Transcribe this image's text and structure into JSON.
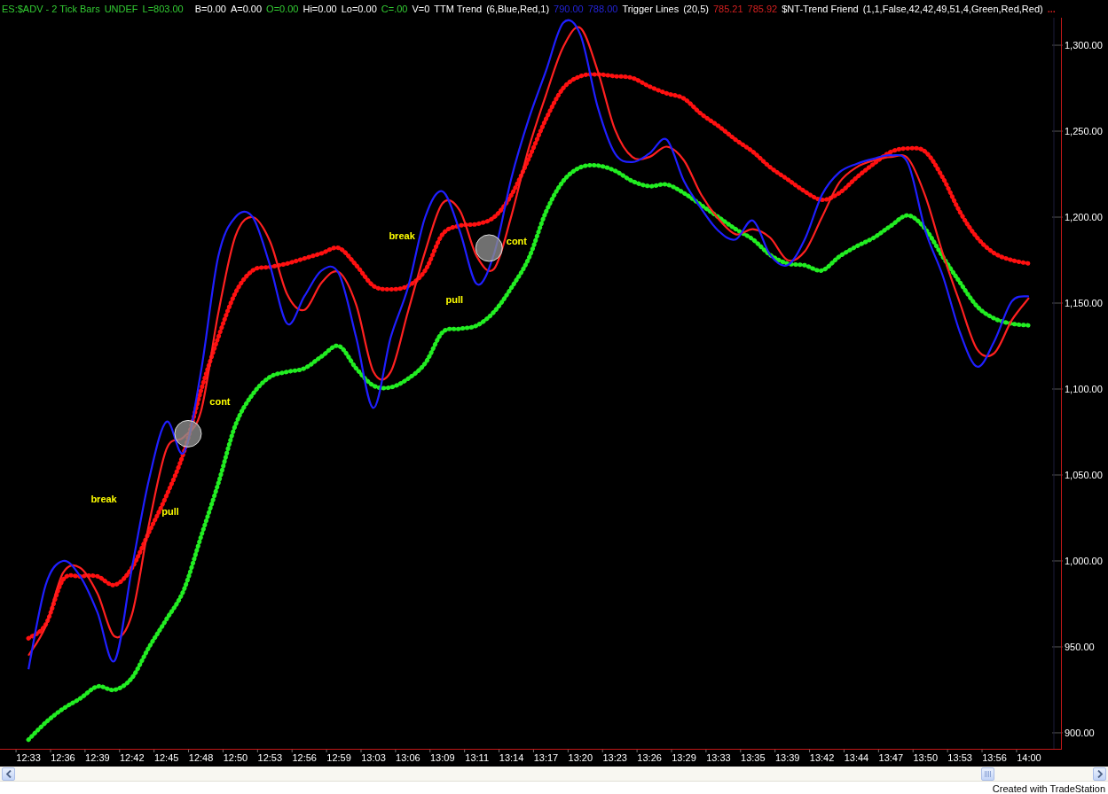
{
  "legend": [
    {
      "items": [
        {
          "text": "ES:$ADV - 2 Tick Bars",
          "color": "#33cc33"
        },
        {
          "text": "UNDEF",
          "color": "#33cc33"
        },
        {
          "text": "L=803.00",
          "color": "#33cc33"
        }
      ]
    },
    {
      "items": [
        {
          "text": "B=0.00",
          "color": "#ffffff"
        },
        {
          "text": "A=0.00",
          "color": "#ffffff"
        },
        {
          "text": "O=0.00",
          "color": "#33cc33"
        },
        {
          "text": "Hi=0.00",
          "color": "#ffffff"
        },
        {
          "text": "Lo=0.00",
          "color": "#ffffff"
        },
        {
          "text": "C=.00",
          "color": "#33cc33"
        },
        {
          "text": "V=0",
          "color": "#ffffff"
        }
      ]
    },
    {
      "items": [
        {
          "text": "TTM Trend",
          "color": "#ffffff"
        },
        {
          "text": "(6,Blue,Red,1)",
          "color": "#ffffff"
        }
      ]
    },
    {
      "items": [
        {
          "text": "790.00",
          "color": "#2424d8"
        },
        {
          "text": "788.00",
          "color": "#2424d8"
        }
      ]
    },
    {
      "items": [
        {
          "text": "Trigger Lines",
          "color": "#ffffff"
        },
        {
          "text": "(20,5)",
          "color": "#ffffff"
        }
      ]
    },
    {
      "items": [
        {
          "text": "785.21",
          "color": "#d42020"
        },
        {
          "text": "785.92",
          "color": "#d42020"
        }
      ]
    },
    {
      "items": [
        {
          "text": "$NT-Trend Friend",
          "color": "#ffffff"
        },
        {
          "text": "(1,1,False,42,42,49,51,4,Green,Red,Red)",
          "color": "#ffffff"
        }
      ]
    },
    {
      "items": [
        {
          "text": "...",
          "color": "#d42020"
        }
      ]
    }
  ],
  "chart": {
    "chart_data": {
      "type": "line",
      "categories": [
        "12:33",
        null,
        "12:36",
        null,
        "12:39",
        null,
        "12:42",
        null,
        "12:45",
        null,
        "12:48",
        null,
        "12:50",
        null,
        "12:53",
        null,
        "12:56",
        null,
        "12:59",
        null,
        "13:03",
        null,
        "13:06",
        null,
        "13:09",
        null,
        "13:11",
        null,
        "13:14",
        null,
        "13:17",
        null,
        "13:20",
        null,
        "13:23",
        null,
        "13:26",
        null,
        "13:29",
        null,
        "13:33",
        null,
        "13:35",
        null,
        "13:39",
        null,
        "13:42",
        null,
        "13:44",
        null,
        "13:47",
        null,
        "13:50",
        null,
        "13:53",
        null,
        "13:56",
        null,
        "14:00"
      ],
      "ylim": [
        890.7,
        1316
      ],
      "yticks": [
        {
          "value": 1300,
          "label": "1,300.00"
        },
        {
          "value": 1250,
          "label": "1,250.00"
        },
        {
          "value": 1200,
          "label": "1,200.00"
        },
        {
          "value": 1150,
          "label": "1,150.00"
        },
        {
          "value": 1100,
          "label": "1,100.00"
        },
        {
          "value": 1050,
          "label": "1,050.00"
        },
        {
          "value": 1000,
          "label": "1,000.00"
        },
        {
          "value": 950,
          "label": "950.00"
        },
        {
          "value": 900,
          "label": "900.00"
        }
      ],
      "series": [
        {
          "color": "#ff1010",
          "line_style": "dotted",
          "values": [
            955,
            963,
            989,
            991,
            991,
            986,
            996,
            1017,
            1038,
            1063,
            1099,
            1130,
            1156,
            1169,
            1171,
            1173,
            1176,
            1179,
            1182,
            1172,
            1160,
            1158,
            1160,
            1169,
            1190,
            1195,
            1196,
            1200,
            1213,
            1234,
            1257,
            1275,
            1282,
            1283,
            1282,
            1281,
            1276,
            1272,
            1269,
            1260,
            1253,
            1245,
            1238,
            1229,
            1222,
            1215,
            1210,
            1214,
            1223,
            1231,
            1238,
            1240,
            1238,
            1223,
            1203,
            1188,
            1179,
            1175,
            1173
          ]
        },
        {
          "color": "#22ee22",
          "line_style": "dotted",
          "values": [
            896,
            906,
            914,
            920,
            927,
            925,
            932,
            950,
            966,
            983,
            1014,
            1045,
            1079,
            1097,
            1107,
            1110,
            1112,
            1119,
            1125,
            1112,
            1102,
            1101,
            1106,
            1115,
            1133,
            1135,
            1137,
            1145,
            1159,
            1176,
            1203,
            1221,
            1229,
            1230,
            1227,
            1221,
            1218,
            1219,
            1214,
            1207,
            1200,
            1193,
            1187,
            1178,
            1173,
            1172,
            1169,
            1177,
            1183,
            1188,
            1195,
            1201,
            1193,
            1177,
            1162,
            1148,
            1141,
            1138,
            1137
          ]
        },
        {
          "color": "#ff2020",
          "line_style": "solid",
          "values": [
            945,
            962,
            993,
            996,
            981,
            956,
            969,
            1022,
            1065,
            1072,
            1087,
            1144,
            1189,
            1200,
            1186,
            1155,
            1146,
            1162,
            1168,
            1149,
            1110,
            1110,
            1145,
            1180,
            1208,
            1204,
            1177,
            1170,
            1201,
            1240,
            1271,
            1299,
            1310,
            1285,
            1251,
            1235,
            1235,
            1241,
            1233,
            1213,
            1199,
            1190,
            1193,
            1188,
            1175,
            1180,
            1200,
            1220,
            1229,
            1233,
            1235,
            1234,
            1212,
            1179,
            1150,
            1123,
            1121,
            1140,
            1153
          ]
        },
        {
          "color": "#1f1fff",
          "line_style": "solid",
          "values": [
            937,
            986,
            1000,
            991,
            970,
            942,
            996,
            1048,
            1081,
            1063,
            1110,
            1177,
            1200,
            1200,
            1172,
            1138,
            1154,
            1169,
            1167,
            1130,
            1089,
            1130,
            1159,
            1200,
            1215,
            1192,
            1161,
            1179,
            1223,
            1257,
            1285,
            1313,
            1306,
            1264,
            1237,
            1232,
            1237,
            1245,
            1221,
            1205,
            1192,
            1187,
            1198,
            1178,
            1172,
            1187,
            1213,
            1226,
            1231,
            1234,
            1236,
            1231,
            1192,
            1166,
            1133,
            1113,
            1128,
            1151,
            1154
          ]
        }
      ],
      "annotations": [
        "break",
        "pull",
        "cont",
        "break",
        "pull",
        "cont"
      ]
    }
  },
  "footer": {
    "credit": "Created with TradeStation"
  }
}
